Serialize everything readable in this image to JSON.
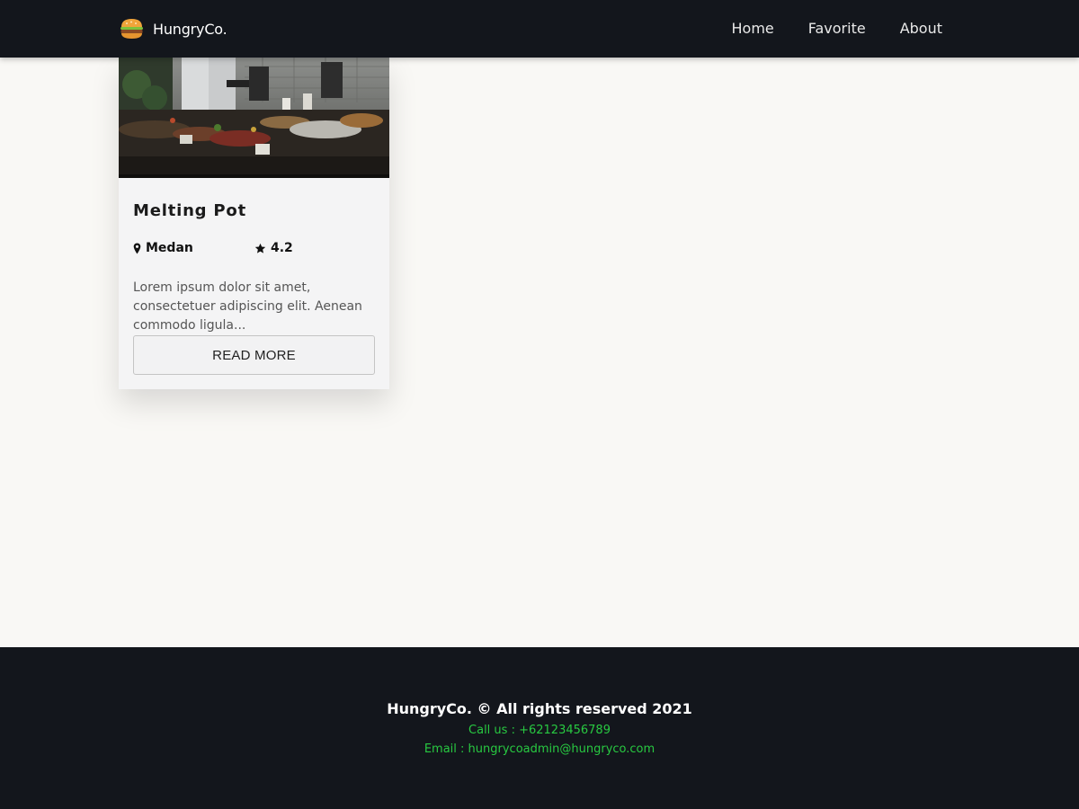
{
  "header": {
    "brand": {
      "name": "HungryCo.",
      "icon": "burger-icon"
    },
    "nav": [
      {
        "label": "Home"
      },
      {
        "label": "Favorite"
      },
      {
        "label": "About"
      }
    ]
  },
  "restaurants": [
    {
      "name": "Melting Pot",
      "location": "Medan",
      "location_icon": "map-pin-icon",
      "rating": "4.2",
      "rating_icon": "star-icon",
      "description": "Lorem ipsum dolor sit amet, consectetuer adipiscing elit. Aenean commodo ligula...",
      "cta_label": "READ MORE"
    }
  ],
  "footer": {
    "copyright": "HungryCo. © All rights reserved 2021",
    "phone": "Call us : +62123456789",
    "email": "Email : hungrycoadmin@hungryco.com"
  },
  "colors": {
    "header_bg": "#13161c",
    "page_bg": "#f9f8f5",
    "footer_accent": "#28c941"
  }
}
